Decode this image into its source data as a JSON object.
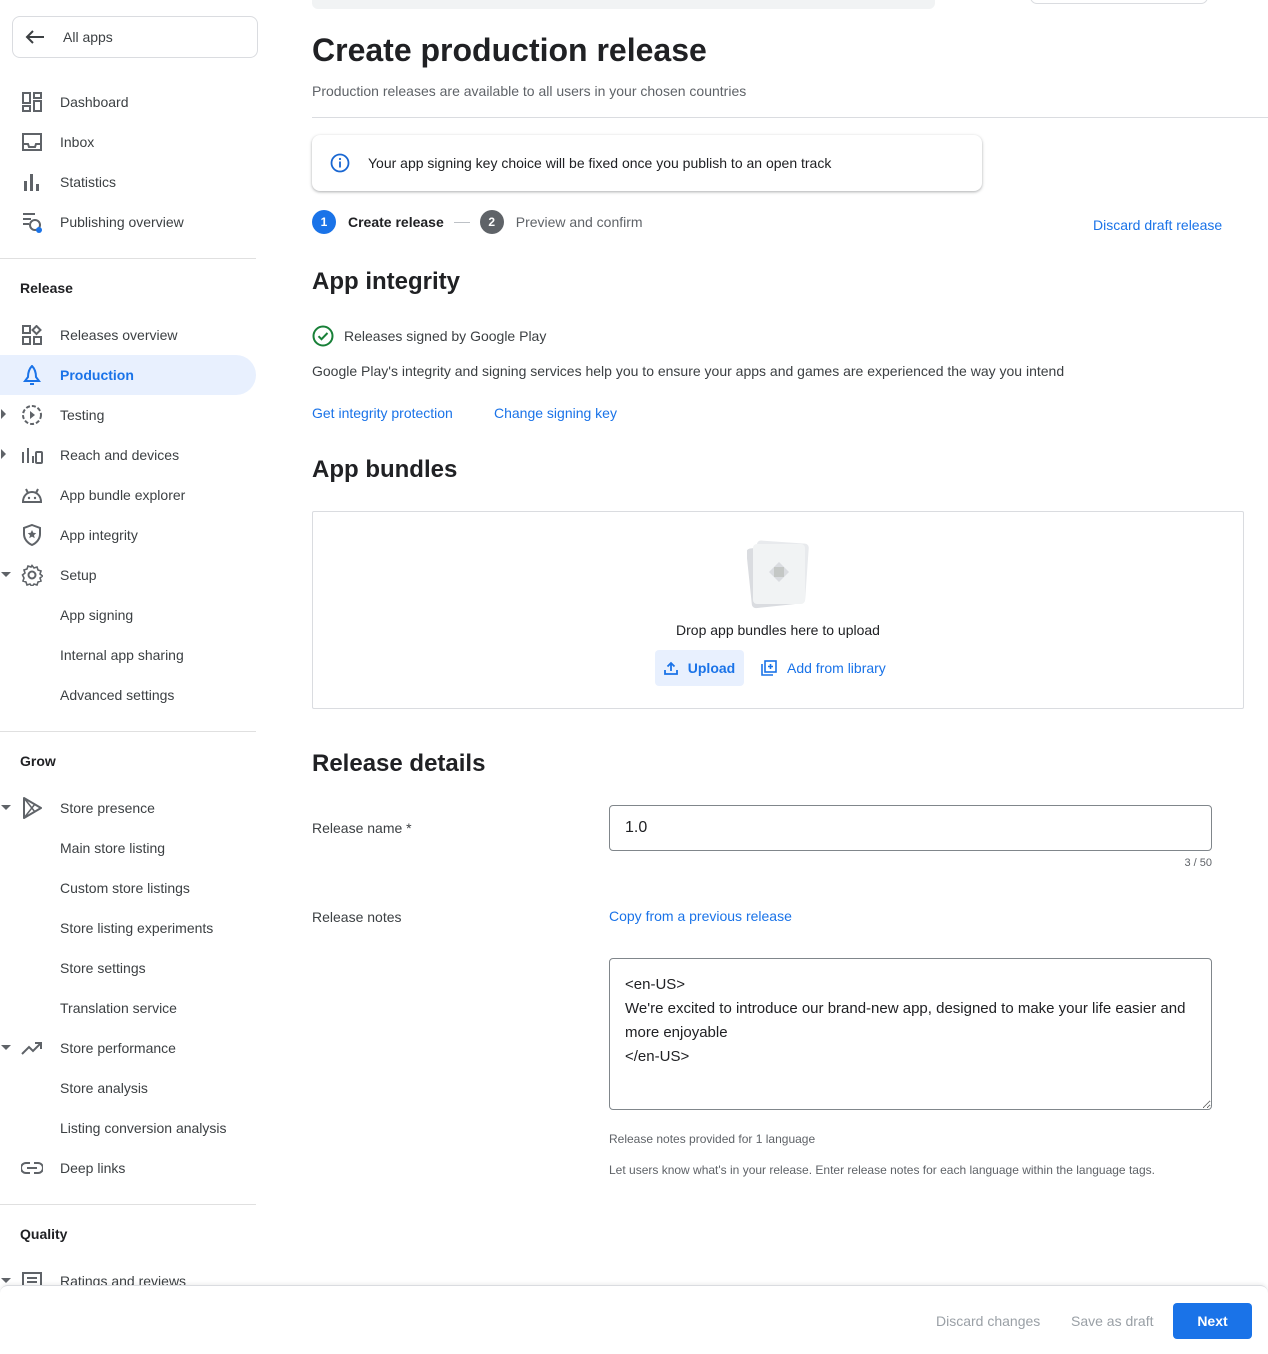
{
  "sidebar": {
    "all_apps": "All apps",
    "items_top": [
      {
        "label": "Dashboard",
        "icon": "dashboard-icon"
      },
      {
        "label": "Inbox",
        "icon": "inbox-icon"
      },
      {
        "label": "Statistics",
        "icon": "statistics-icon"
      },
      {
        "label": "Publishing overview",
        "icon": "publishing-overview-icon"
      }
    ],
    "release_section": "Release",
    "release_items": [
      {
        "label": "Releases overview",
        "icon": "releases-overview-icon"
      },
      {
        "label": "Production",
        "icon": "production-icon",
        "active": true
      },
      {
        "label": "Testing",
        "icon": "testing-icon"
      },
      {
        "label": "Reach and devices",
        "icon": "reach-devices-icon"
      },
      {
        "label": "App bundle explorer",
        "icon": "android-icon"
      },
      {
        "label": "App integrity",
        "icon": "shield-icon"
      },
      {
        "label": "Setup",
        "icon": "gear-icon"
      },
      {
        "label": "App signing"
      },
      {
        "label": "Internal app sharing"
      },
      {
        "label": "Advanced settings"
      }
    ],
    "grow_section": "Grow",
    "grow_items": [
      {
        "label": "Store presence",
        "icon": "play-store-icon"
      },
      {
        "label": "Main store listing"
      },
      {
        "label": "Custom store listings"
      },
      {
        "label": "Store listing experiments"
      },
      {
        "label": "Store settings"
      },
      {
        "label": "Translation service"
      },
      {
        "label": "Store performance",
        "icon": "trending-up-icon"
      },
      {
        "label": "Store analysis"
      },
      {
        "label": "Listing conversion analysis"
      },
      {
        "label": "Deep links",
        "icon": "link-icon"
      }
    ],
    "quality_section": "Quality",
    "quality_items": [
      {
        "label": "Ratings and reviews",
        "icon": "reviews-icon"
      }
    ]
  },
  "header": {
    "title": "Create production release",
    "subtitle": "Production releases are available to all users in your chosen countries"
  },
  "banner": {
    "text": "Your app signing key choice will be fixed once you publish to an open track"
  },
  "stepper": {
    "step1_num": "1",
    "step1_label": "Create release",
    "step2_num": "2",
    "step2_label": "Preview and confirm",
    "discard_draft": "Discard draft release"
  },
  "integrity": {
    "title": "App integrity",
    "signed_text": "Releases signed by Google Play",
    "description": "Google Play's integrity and signing services help you to ensure your apps and games are experienced the way you intend",
    "get_protection": "Get integrity protection",
    "change_key": "Change signing key"
  },
  "bundles": {
    "title": "App bundles",
    "drop_text": "Drop app bundles here to upload",
    "upload": "Upload",
    "add_library": "Add from library"
  },
  "details": {
    "title": "Release details",
    "name_label": "Release name  *",
    "name_value": "1.0",
    "name_counter": "3 / 50",
    "notes_label": "Release notes",
    "copy_previous": "Copy from a previous release",
    "notes_value": "<en-US>\nWe're excited to introduce our brand-new app, designed to make your life easier and more enjoyable\n</en-US>",
    "notes_count": "Release notes provided for 1 language",
    "notes_hint": "Let users know what's in your release. Enter release notes for each language within the language tags."
  },
  "footer": {
    "discard_changes": "Discard changes",
    "save_draft": "Save as draft",
    "next": "Next"
  },
  "colors": {
    "accent": "#1a73e8",
    "active_bg": "#e8f0fe",
    "success": "#188038"
  }
}
